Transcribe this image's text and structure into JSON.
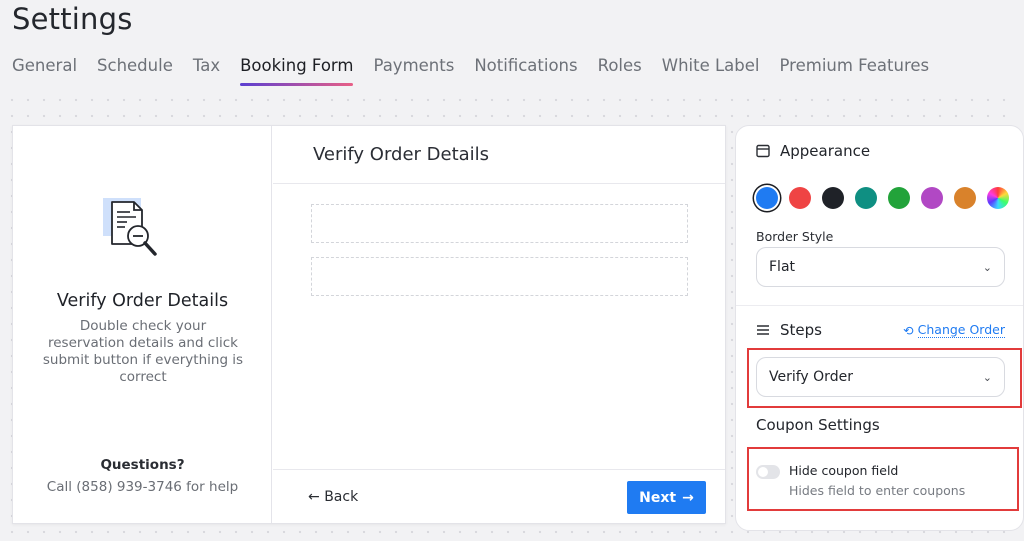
{
  "page": {
    "title": "Settings"
  },
  "tabs": [
    {
      "label": "General"
    },
    {
      "label": "Schedule"
    },
    {
      "label": "Tax"
    },
    {
      "label": "Booking Form",
      "active": true
    },
    {
      "label": "Payments"
    },
    {
      "label": "Notifications"
    },
    {
      "label": "Roles"
    },
    {
      "label": "White Label"
    },
    {
      "label": "Premium Features"
    }
  ],
  "preview": {
    "left": {
      "illustration_icon": "document-magnifier-icon",
      "heading": "Verify Order Details",
      "description": "Double check your reservation details and click submit button if everything is correct",
      "questions_label": "Questions?",
      "contact_text": "Call (858) 939-3746 for help"
    },
    "right": {
      "heading": "Verify Order Details",
      "back_label": "Back",
      "next_label": "Next"
    }
  },
  "panel": {
    "appearance": {
      "heading": "Appearance",
      "icon": "window-icon",
      "colors": [
        "#1f7bf2",
        "#ef4444",
        "#1f2228",
        "#0f8f82",
        "#22a33a",
        "#b148c4",
        "#d9822b",
        "rainbow"
      ],
      "selected_color": "#1f7bf2",
      "border_style_label": "Border Style",
      "border_style_value": "Flat"
    },
    "steps": {
      "heading": "Steps",
      "icon": "list-icon",
      "change_order_label": "Change Order",
      "selected_step": "Verify Order"
    },
    "coupon": {
      "heading": "Coupon Settings",
      "toggle_label": "Hide coupon field",
      "toggle_description": "Hides field to enter coupons",
      "toggle_on": false
    },
    "highlight_color": "#e23b3b"
  }
}
